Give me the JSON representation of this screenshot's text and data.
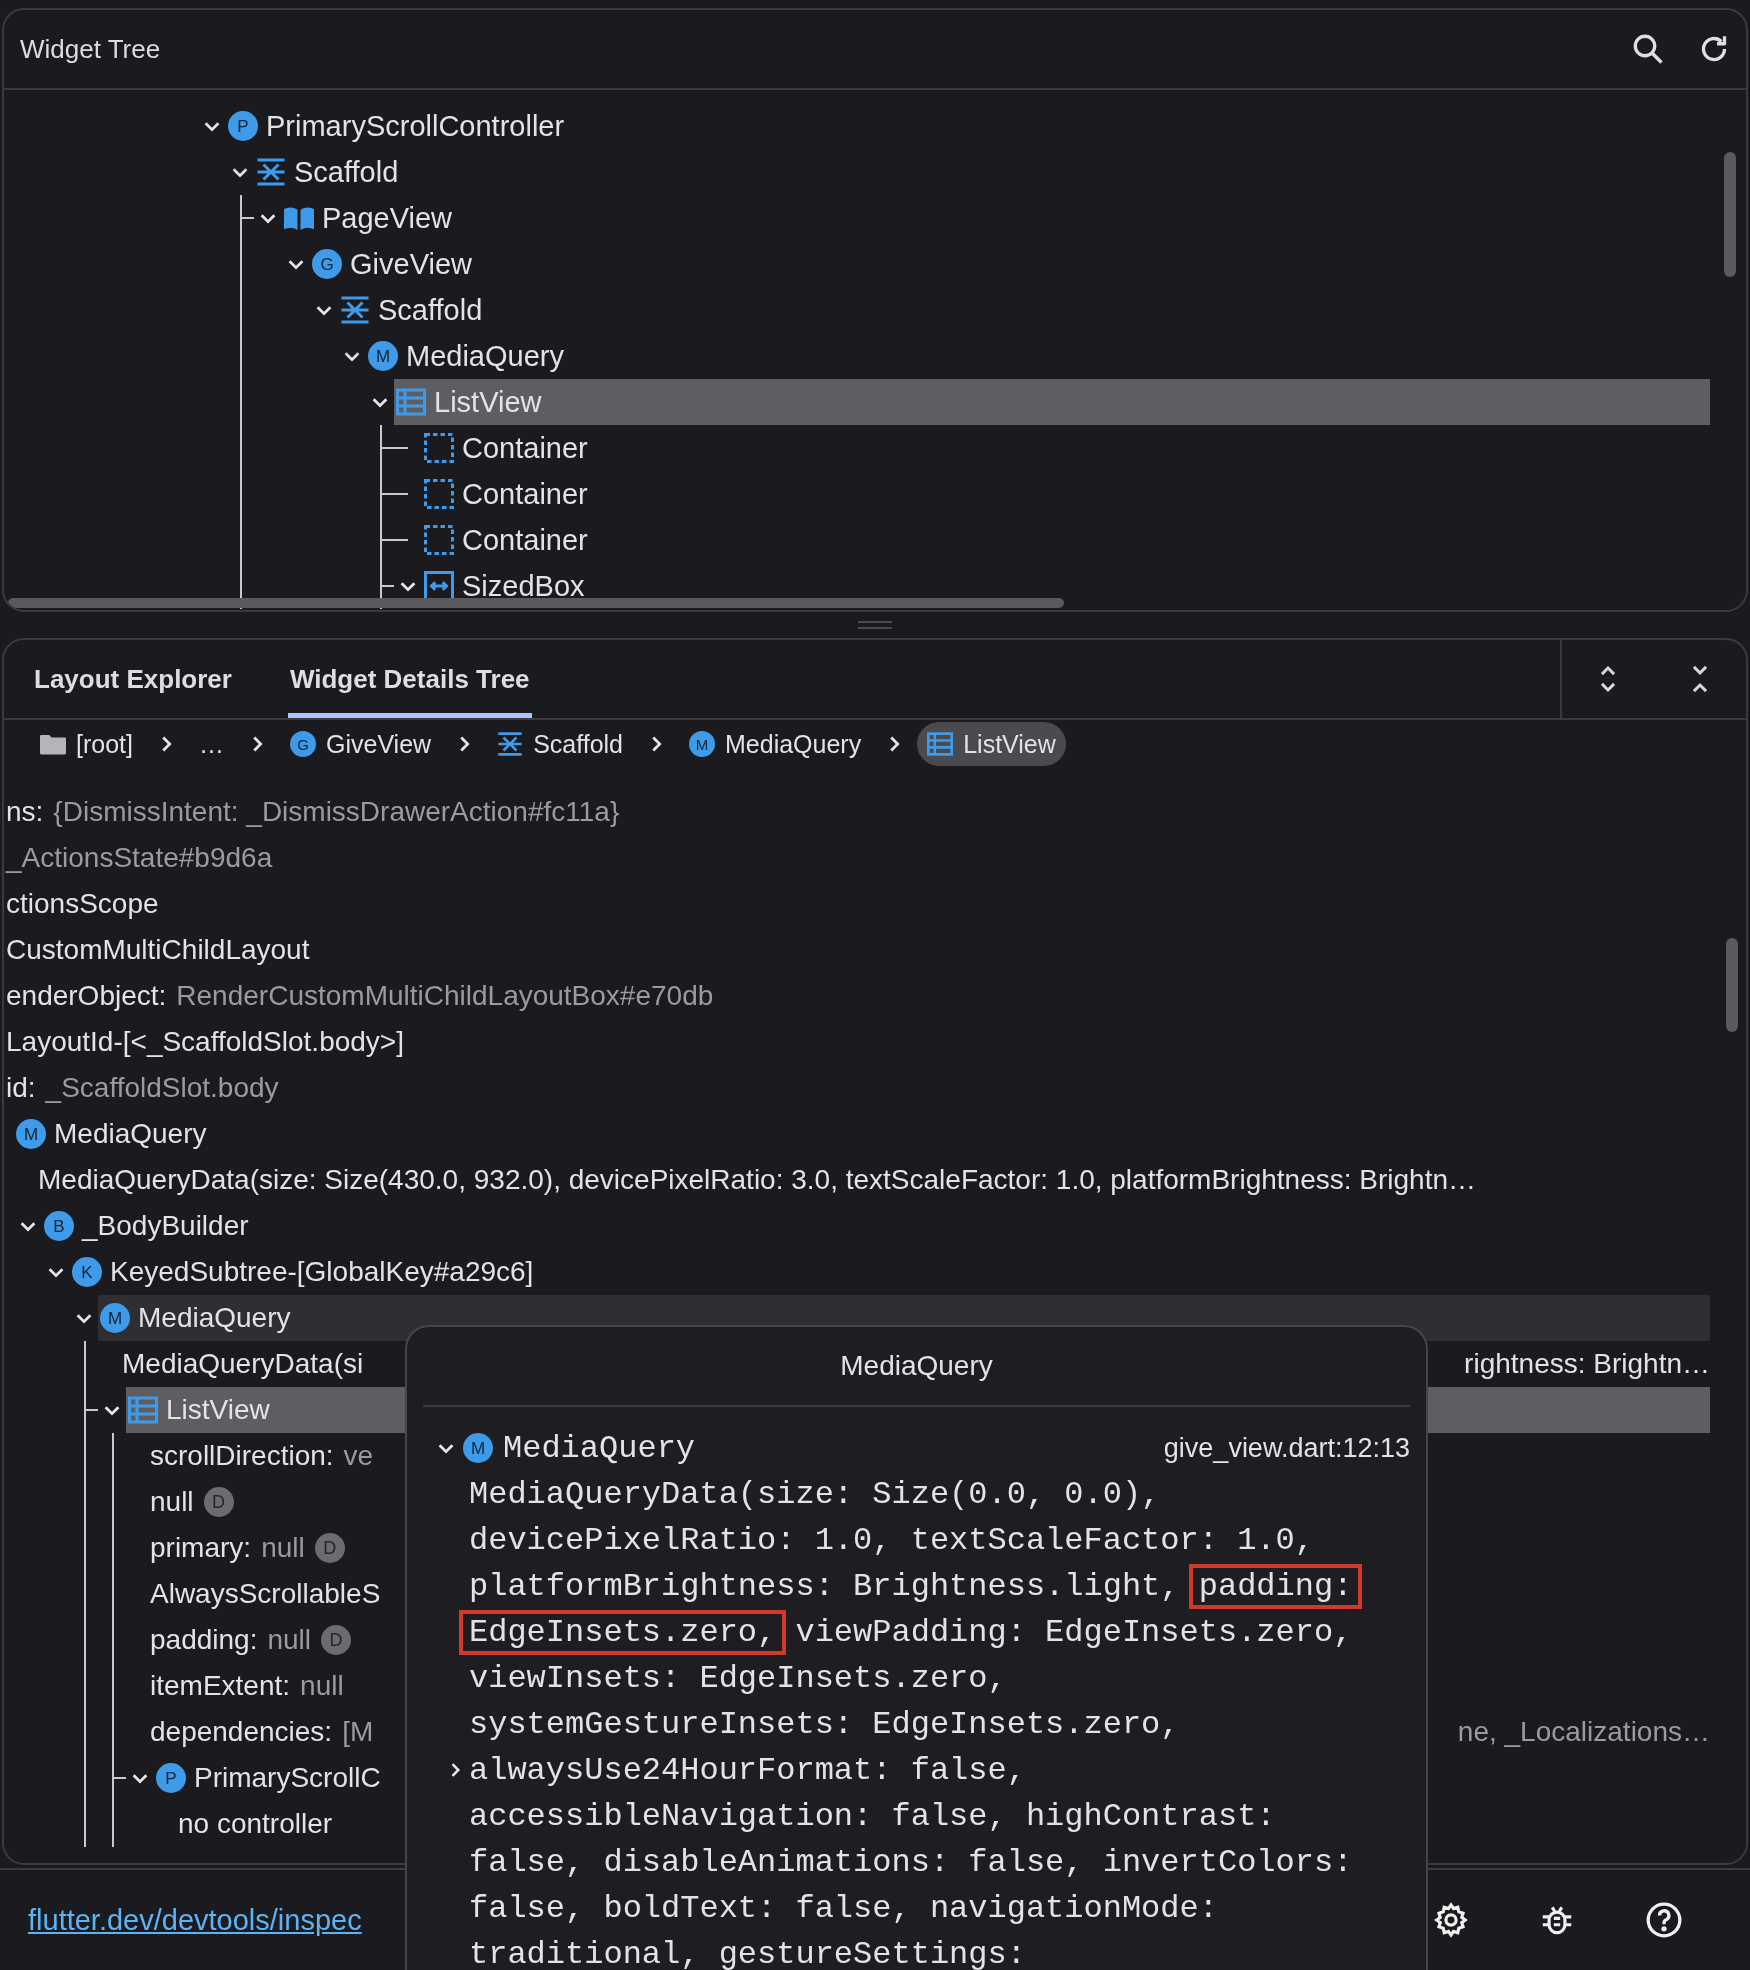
{
  "widget_tree": {
    "title": "Widget Tree",
    "nodes": [
      {
        "label": "PrimaryScrollController",
        "badge": "P",
        "expanded": true,
        "selected": false,
        "line": false,
        "children": [
          {
            "label": "Scaffold",
            "kind": "scaffold",
            "expanded": true,
            "selected": false,
            "line": false,
            "children": [
              {
                "label": "PageView",
                "kind": "pageview",
                "expanded": true,
                "selected": false,
                "line": true,
                "children": [
                  {
                    "label": "GiveView",
                    "badge": "G",
                    "expanded": true,
                    "selected": false,
                    "line": false,
                    "children": [
                      {
                        "label": "Scaffold",
                        "kind": "scaffold",
                        "expanded": true,
                        "selected": false,
                        "line": false,
                        "children": [
                          {
                            "label": "MediaQuery",
                            "badge": "M",
                            "expanded": true,
                            "selected": false,
                            "line": false,
                            "children": [
                              {
                                "label": "ListView",
                                "kind": "listview",
                                "expanded": true,
                                "selected": true,
                                "line": false,
                                "children": [
                                  {
                                    "label": "Container",
                                    "kind": "container",
                                    "selected": false,
                                    "line": true
                                  },
                                  {
                                    "label": "Container",
                                    "kind": "container",
                                    "selected": false,
                                    "line": true
                                  },
                                  {
                                    "label": "Container",
                                    "kind": "container",
                                    "selected": false,
                                    "line": true
                                  },
                                  {
                                    "label": "SizedBox",
                                    "kind": "sizedbox",
                                    "expanded": true,
                                    "selected": false,
                                    "line": true
                                  }
                                ]
                              }
                            ]
                          }
                        ]
                      }
                    ]
                  }
                ]
              }
            ]
          }
        ]
      }
    ]
  },
  "details": {
    "tabs": [
      {
        "label": "Layout Explorer",
        "selected": false
      },
      {
        "label": "Widget Details Tree",
        "selected": true
      }
    ],
    "breadcrumbs": [
      {
        "label": "[root]",
        "kind": "folder",
        "selected": false
      },
      {
        "label": "…",
        "selected": false
      },
      {
        "label": "GiveView",
        "badge": "G",
        "selected": false
      },
      {
        "label": "Scaffold",
        "kind": "scaffold",
        "selected": false
      },
      {
        "label": "MediaQuery",
        "badge": "M",
        "selected": false
      },
      {
        "label": "ListView",
        "kind": "listview",
        "selected": true
      }
    ],
    "cut_rows": [
      {
        "name": "ns:",
        "value": "{DismissIntent: _DismissDrawerAction#fc11a}"
      },
      {
        "value": "_ActionsState#b9d6a"
      },
      {
        "name": "ctionsScope"
      },
      {
        "name": "CustomMultiChildLayout"
      },
      {
        "name": "enderObject:",
        "value": "RenderCustomMultiChildLayoutBox#e70db"
      },
      {
        "name": "LayoutId-[<_ScaffoldSlot.body>]"
      },
      {
        "name": "id:",
        "value": "_ScaffoldSlot.body"
      }
    ],
    "nodes": [
      {
        "label": "MediaQuery",
        "badge": "M",
        "selected": false,
        "highlighted": false,
        "line": false,
        "properties": [
          {
            "name": "MediaQueryData(size: Size(430.0, 932.0), devicePixelRatio: 3.0, textScaleFactor: 1.0, platformBrightness: Brightn…"
          }
        ],
        "children": [
          {
            "label": "_BodyBuilder",
            "badge": "B",
            "expanded": true,
            "selected": false,
            "highlighted": false,
            "line": false,
            "children": [
              {
                "label": "KeyedSubtree-[GlobalKey#a29c6]",
                "badge": "K",
                "expanded": true,
                "selected": false,
                "highlighted": false,
                "line": false,
                "children": [
                  {
                    "label": "MediaQuery",
                    "badge": "M",
                    "expanded": true,
                    "selected": false,
                    "highlighted": true,
                    "line": false,
                    "properties": [
                      {
                        "name": "MediaQueryData(si",
                        "right": "rightness: Brightn…"
                      }
                    ],
                    "children": [
                      {
                        "label": "ListView",
                        "kind": "listview",
                        "expanded": true,
                        "selected": true,
                        "line": true,
                        "properties": [
                          {
                            "name": "scrollDirection:",
                            "value": "ve"
                          },
                          {
                            "name": "null",
                            "badge": "D"
                          },
                          {
                            "name": "primary:",
                            "value": "null",
                            "badge": "D"
                          },
                          {
                            "name": "AlwaysScrollableS"
                          },
                          {
                            "name": "padding:",
                            "value": "null",
                            "badge": "D"
                          },
                          {
                            "name": "itemExtent:",
                            "value": "null"
                          },
                          {
                            "name": "dependencies:",
                            "value": "[M",
                            "right": "ne, _Localizations…"
                          }
                        ],
                        "children": [
                          {
                            "label": "PrimaryScrollC",
                            "badge": "P",
                            "expanded": true,
                            "selected": false,
                            "highlighted": false,
                            "line": true,
                            "properties": [
                              {
                                "name": "no controller"
                              }
                            ]
                          }
                        ]
                      }
                    ]
                  }
                ]
              }
            ]
          }
        ]
      }
    ]
  },
  "popup": {
    "title": "MediaQuery",
    "node": {
      "label": "MediaQuery",
      "badge": "M",
      "expanded": true,
      "location": "give_view.dart:12:13"
    },
    "lines": [
      {
        "parts": [
          {
            "text": "MediaQueryData(size: Size(0.0, 0.0),",
            "boxed": false
          }
        ]
      },
      {
        "parts": [
          {
            "text": "devicePixelRatio: 1.0, textScaleFactor: 1.0,",
            "boxed": false
          }
        ]
      },
      {
        "parts": [
          {
            "text": "platformBrightness: Brightness.light, ",
            "boxed": false
          },
          {
            "text": "padding:",
            "boxed": true
          }
        ]
      },
      {
        "parts": [
          {
            "text": "EdgeInsets.zero,",
            "boxed": true
          },
          {
            "text": " viewPadding: EdgeInsets.zero,",
            "boxed": false
          }
        ]
      },
      {
        "parts": [
          {
            "text": "viewInsets: EdgeInsets.zero,",
            "boxed": false
          }
        ]
      },
      {
        "parts": [
          {
            "text": "systemGestureInsets: EdgeInsets.zero,",
            "boxed": false
          }
        ]
      },
      {
        "expanded": false,
        "parts": [
          {
            "text": "alwaysUse24HourFormat: false,",
            "boxed": false
          }
        ]
      },
      {
        "parts": [
          {
            "text": "accessibleNavigation: false, highContrast:",
            "boxed": false
          }
        ]
      },
      {
        "parts": [
          {
            "text": "false, disableAnimations: false, invertColors:",
            "boxed": false
          }
        ]
      },
      {
        "parts": [
          {
            "text": "false, boldText: false, navigationMode:",
            "boxed": false
          }
        ]
      },
      {
        "parts": [
          {
            "text": "traditional, gestureSettings:",
            "boxed": false
          }
        ]
      }
    ]
  },
  "footer": {
    "link": "flutter.dev/devtools/inspec"
  }
}
